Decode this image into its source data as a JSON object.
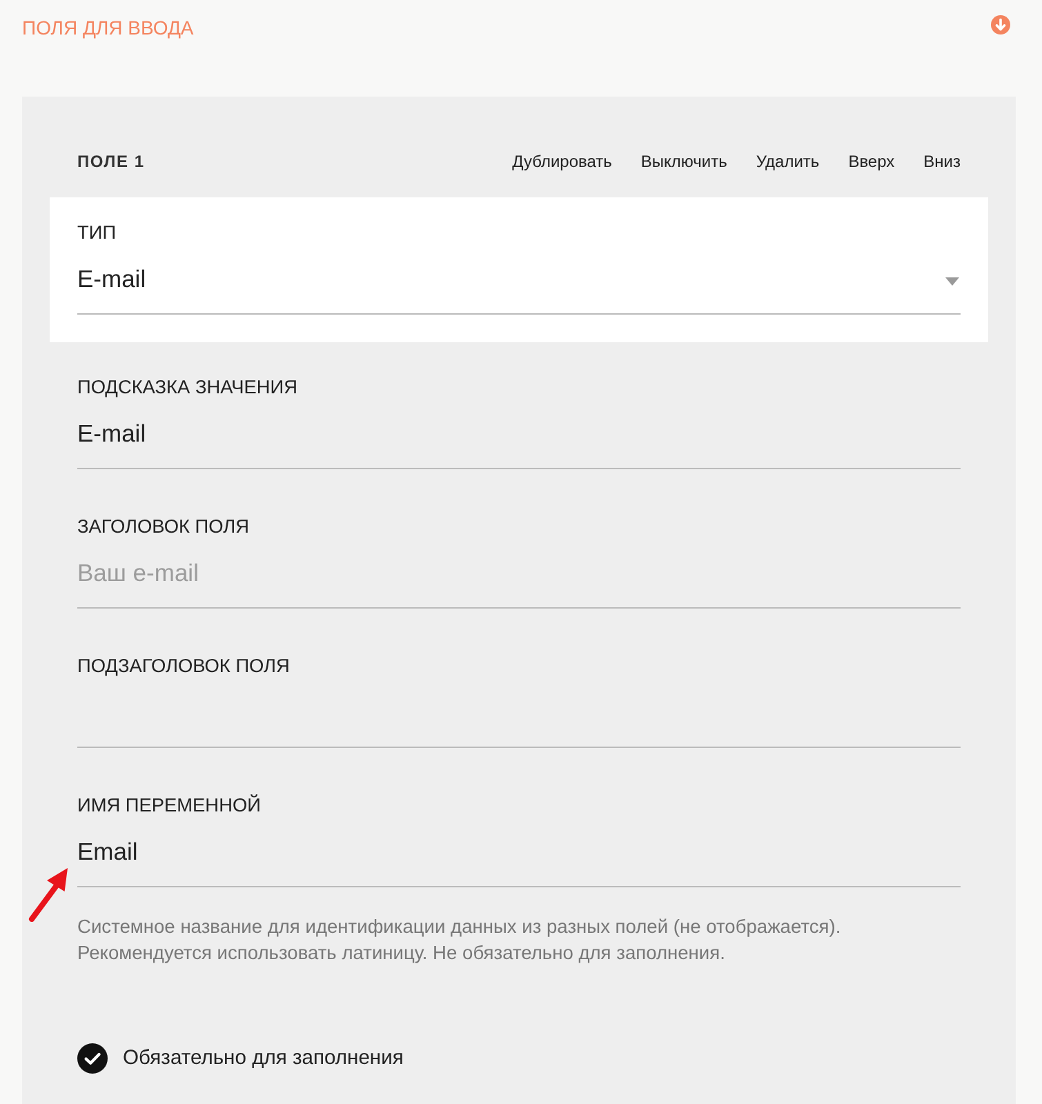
{
  "section": {
    "title": "ПОЛЯ ДЛЯ ВВОДА"
  },
  "field_card": {
    "title": "ПОЛЕ 1",
    "actions": [
      "Дублировать",
      "Выключить",
      "Удалить",
      "Вверх",
      "Вниз"
    ],
    "type_select": {
      "label": "ТИП",
      "value": "E-mail"
    },
    "inputs": [
      {
        "label": "ПОДСКАЗКА ЗНАЧЕНИЯ",
        "value": "E-mail"
      },
      {
        "label": "ЗАГОЛОВОК ПОЛЯ",
        "placeholder": "Ваш e-mail"
      },
      {
        "label": "ПОДЗАГОЛОВОК ПОЛЯ"
      },
      {
        "label": "ИМЯ ПЕРЕМЕННОЙ",
        "value": "Email",
        "help": "Системное название для идентификации данных из разных полей (не отображается). Рекомендуется использовать латиницу. Не обязательно для заполнения."
      }
    ],
    "required": {
      "label": "Обязательно для заполнения",
      "checked": true
    }
  }
}
